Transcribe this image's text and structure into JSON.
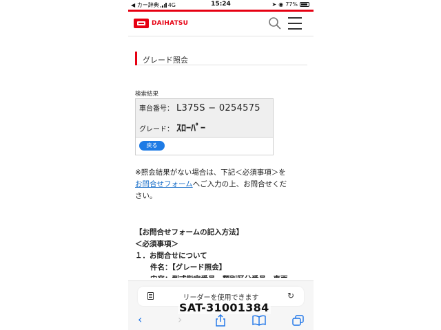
{
  "status_bar": {
    "carrier": "◀ カー辞典",
    "network": "4G",
    "time": "15:24",
    "location_icon": "location-arrow-icon",
    "battery": "77%"
  },
  "header": {
    "brand": "DAIHATSU",
    "brand_color": "#e60012",
    "icons": [
      "search-icon",
      "hamburger-menu-icon"
    ]
  },
  "section": {
    "title": "グレード照会"
  },
  "results": {
    "label": "検索結果",
    "chassis_label": "車台番号：",
    "chassis_value": "L375S − 0254575",
    "grade_label": "グレード：",
    "grade_value": "ｽﾛｰﾊﾟｰ",
    "back_button": "戻る",
    "back_button_color": "#1e7be5"
  },
  "note": {
    "line1": "※照会結果がない場合は、下記＜必須事項＞を",
    "link": "お問合せフォーム",
    "line2_rest": "へご入力の上、お問合せくだ",
    "line3": "さい。"
  },
  "method": {
    "heading": "【お問合せフォームの記入方法】",
    "required": "＜必須事項＞",
    "item1": "１．お問合せについて",
    "subject": "件名：【グレード照会】",
    "content_cut": "内容：型式指定番号　類別区分番号　車両"
  },
  "browser": {
    "reader_text": "リーダーを使用できます",
    "icons": [
      "document-icon",
      "reload-icon",
      "back-icon",
      "forward-icon",
      "share-icon",
      "bookmarks-icon",
      "tabs-icon"
    ]
  },
  "watermark": "SAT-31001384"
}
